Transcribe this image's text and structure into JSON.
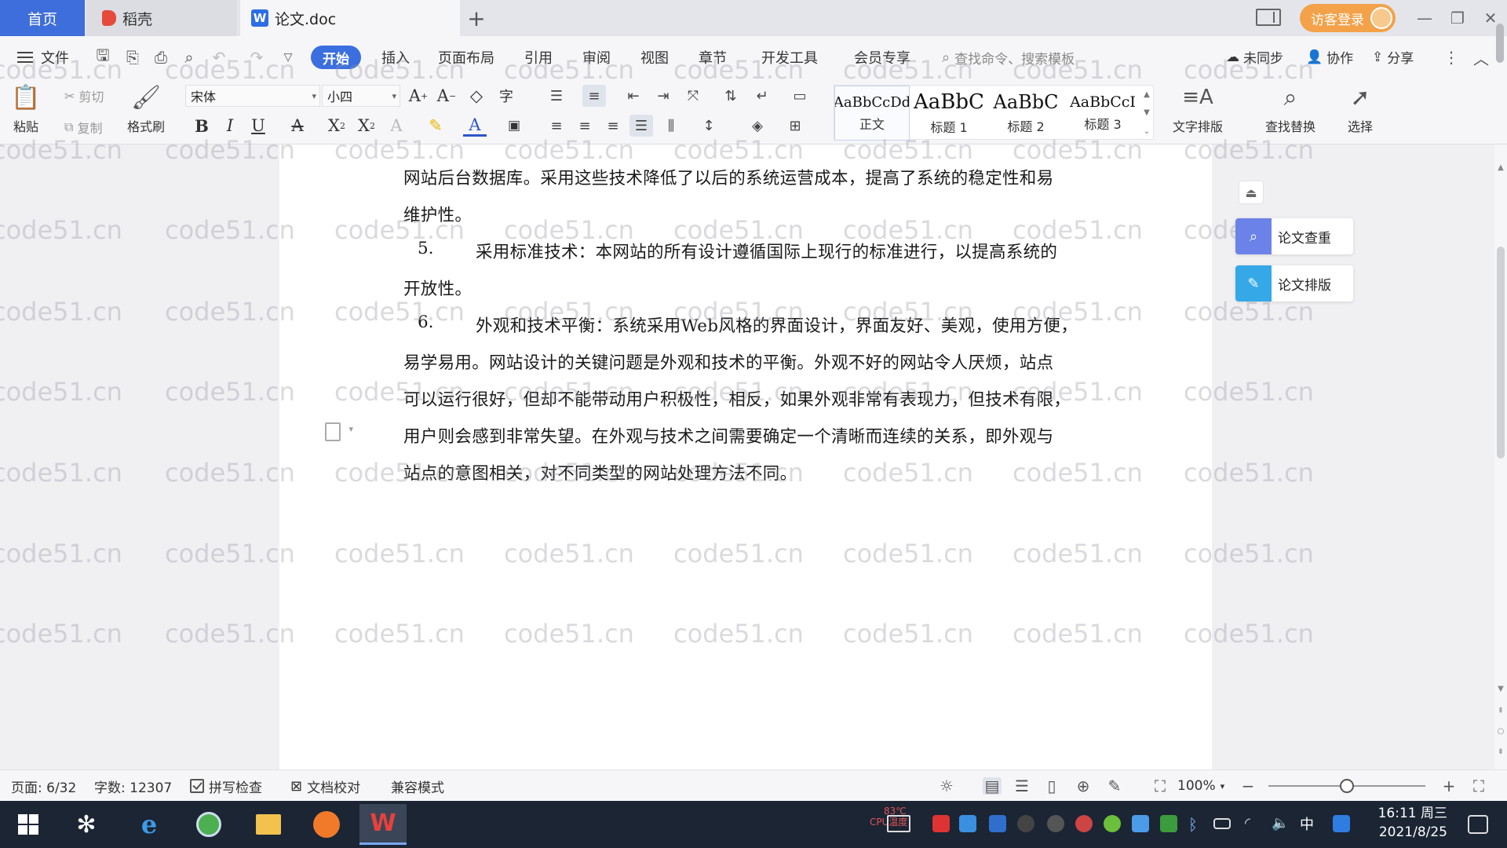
{
  "tabs": {
    "home": "首页",
    "daoke": "稻壳",
    "doc": "论文.doc",
    "add": "+"
  },
  "titlebar": {
    "login": "访客登录"
  },
  "menu": {
    "file": "文件",
    "items": [
      "开始",
      "插入",
      "页面布局",
      "引用",
      "审阅",
      "视图",
      "章节",
      "开发工具",
      "会员专享"
    ],
    "search": "查找命令、搜索模板",
    "sync": "未同步",
    "collab": "协作",
    "share": "分享"
  },
  "ribbon": {
    "paste": "粘贴",
    "cut": "剪切",
    "copy": "复制",
    "format_painter": "格式刷",
    "font_name": "宋体",
    "font_size": "小四",
    "styles": [
      {
        "preview": "AaBbCcDd",
        "label": "正文"
      },
      {
        "preview": "AaBbC",
        "label": "标题 1"
      },
      {
        "preview": "AaBbC",
        "label": "标题 2"
      },
      {
        "preview": "AaBbCcI",
        "label": "标题 3"
      }
    ],
    "text_layout": "文字排版",
    "find_replace": "查找替换",
    "select": "选择"
  },
  "document": {
    "lines": [
      "网站后台数据库。采用这些技术降低了以后的系统运营成本，提高了系统的稳定性和易",
      "维护性。",
      "采用标准技术：本网站的所有设计遵循国际上现行的标准进行，以提高系统的",
      "开放性。",
      "外观和技术平衡：系统采用Web风格的界面设计，界面友好、美观，使用方便，",
      "易学易用。网站设计的关键问题是外观和技术的平衡。外观不好的网站令人厌烦，站点",
      "可以运行很好，但却不能带动用户积极性，相反，如果外观非常有表现力，但技术有限，",
      "用户则会感到非常失望。在外观与技术之间需要确定一个清晰而连续的关系，即外观与",
      "站点的意图相关，对不同类型的网站处理方法不同。"
    ],
    "list_numbers": [
      "5.",
      "6."
    ],
    "watermark": "code51.cn"
  },
  "side_panel": {
    "check": "论文查重",
    "layout": "论文排版"
  },
  "status": {
    "page": "页面: 6/32",
    "words": "字数: 12307",
    "spell": "拼写检查",
    "proof": "文档校对",
    "compat": "兼容模式",
    "zoom": "100%"
  },
  "taskbar": {
    "time": "16:11 周三",
    "date": "2021/8/25",
    "ime": "中",
    "cpu_temp": "83℃",
    "cpu_label": "CPU温度"
  },
  "colors": {
    "accent": "#3b6fe0",
    "login": "#f3a24a",
    "taskbar": "#1b2534",
    "check_icon": "#6b83e8",
    "layout_icon": "#35a8e8"
  }
}
